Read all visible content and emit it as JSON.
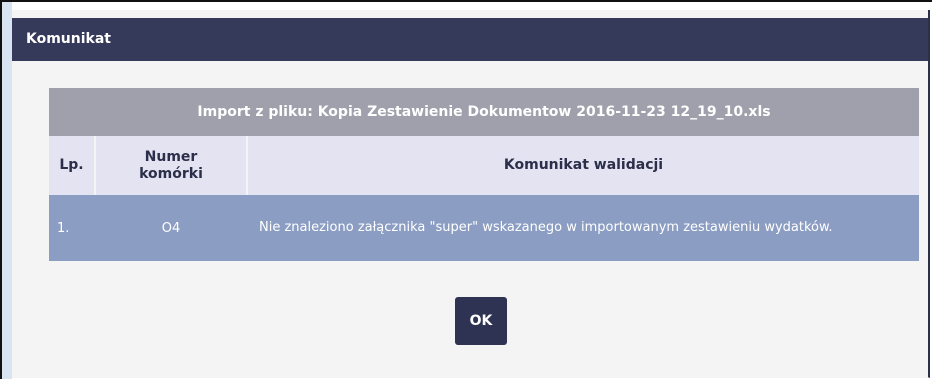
{
  "dialog": {
    "title": "Komunikat",
    "ok_label": "OK"
  },
  "table": {
    "caption": "Import z pliku: Kopia Zestawienie Dokumentow 2016-11-23 12_19_10.xls",
    "headers": {
      "lp": "Lp.",
      "cell_number_line1": "Numer",
      "cell_number_line2": "komórki",
      "message": "Komunikat walidacji"
    },
    "rows": [
      {
        "lp": "1.",
        "cell": "O4",
        "message": "Nie znaleziono załącznika \"super\" wskazanego w importowanym zestawieniu wydatków."
      }
    ]
  },
  "colors": {
    "header_bg": "#363a5a",
    "caption_bg": "#a0a0ac",
    "column_header_bg": "#e3e3f1",
    "row_bg": "#8b9dc2",
    "button_bg": "#2e3253"
  }
}
